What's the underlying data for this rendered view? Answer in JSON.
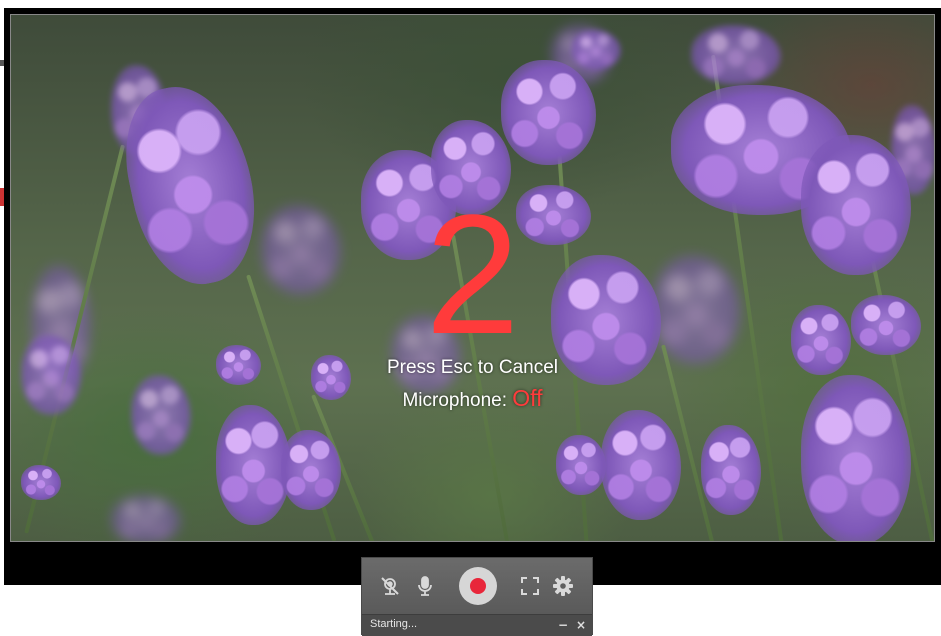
{
  "overlay": {
    "countdown": "2",
    "cancel_hint": "Press Esc to Cancel",
    "microphone_label": "Microphone:",
    "microphone_state": "Off"
  },
  "toolbar": {
    "icons": [
      "webcam-off-icon",
      "microphone-icon",
      "record-icon",
      "fullscreen-icon",
      "gear-icon"
    ],
    "status_text": "Starting...",
    "minimize_label": "−",
    "close_label": "×"
  },
  "colors": {
    "accent_red": "#ff3b3b",
    "record_red": "#e8263a",
    "toolbar_bg": "#5d5d5d"
  }
}
